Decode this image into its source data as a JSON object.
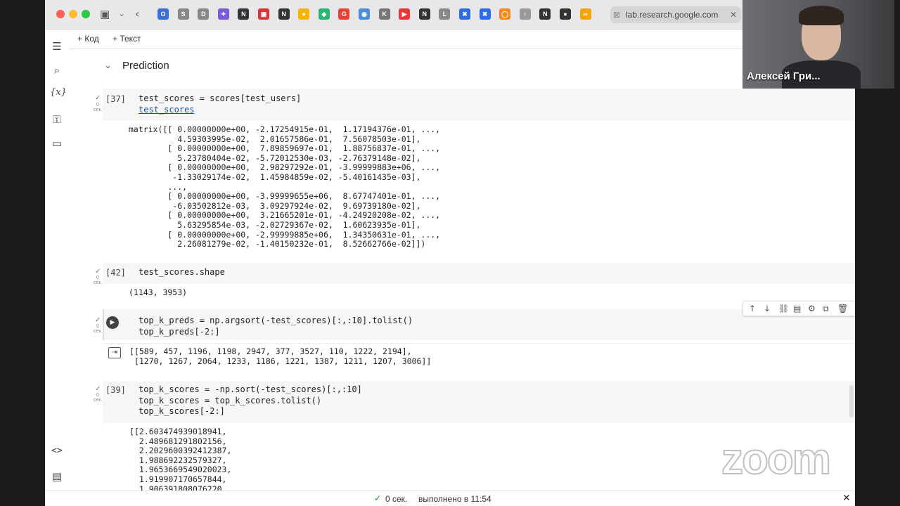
{
  "browser": {
    "url": "lab.research.google.com",
    "tab_icons": [
      "O",
      "S",
      "D",
      "✦",
      "N",
      "▣",
      "N",
      "●",
      "◆",
      "G",
      "◉",
      "K",
      "▶",
      "N",
      "L",
      "✖",
      "✖",
      "◯",
      "♀",
      "N",
      "●",
      "∞"
    ]
  },
  "toolbar": {
    "add_code": "+ Код",
    "add_text": "+ Текст"
  },
  "section": {
    "title": "Prediction"
  },
  "cells": [
    {
      "exec": "[37]",
      "time": "0\nсек.",
      "code": [
        "test_scores = scores[test_users]",
        "test_scores"
      ],
      "output": "matrix([[ 0.00000000e+00, -2.17254915e-01,  1.17194376e-01, ...,\n          4.59303995e-02,  2.01657586e-01,  7.56078503e-01],\n        [ 0.00000000e+00,  7.89859697e-01,  1.88756837e-01, ...,\n          5.23780404e-02, -5.72012530e-03, -2.76379148e-02],\n        [ 0.00000000e+00,  2.98297292e-01, -3.99999883e+06, ...,\n         -1.33029174e-02,  1.45984859e-02, -5.40161435e-03],\n        ...,\n        [ 0.00000000e+00, -3.99999655e+06,  8.67747401e-01, ...,\n         -6.03502812e-03,  3.09297924e-02,  9.69739180e-02],\n        [ 0.00000000e+00,  3.21665201e-01, -4.24920208e-02, ...,\n          5.63295854e-03, -2.02729367e-02,  1.60623935e-01],\n        [ 0.00000000e+00, -2.99999885e+06,  1.34350631e-01, ...,\n          2.26081279e-02, -1.40150232e-01,  8.52662766e-02]])"
    },
    {
      "exec": "[42]",
      "time": "0\nсек.",
      "code": [
        "test_scores.shape"
      ],
      "output": "(1143, 3953)"
    },
    {
      "exec": "",
      "time": "0\nсек.",
      "code": [
        "top_k_preds = np.argsort(-test_scores)[:,:10].tolist()",
        "top_k_preds[-2:]"
      ],
      "output": "[[589, 457, 1196, 1198, 2947, 377, 3527, 110, 1222, 2194],\n [1270, 1267, 2064, 1233, 1186, 1221, 1387, 1211, 1207, 3006]]"
    },
    {
      "exec": "[39]",
      "time": "0\nсек.",
      "code": [
        "top_k_scores = -np.sort(-test_scores)[:,:10]",
        "top_k_scores = top_k_scores.tolist()",
        "top_k_scores[-2:]"
      ],
      "output": "[[2.603474939018941,\n  2.489681291802156,\n  2.2029600392412387,\n  1.988692232579327,\n  1.9653669549020023,\n  1.919907170657844,\n  1.906391808076220"
    }
  ],
  "status": {
    "check": "✓",
    "time": "0 сек.",
    "done": "выполнено в 11:54"
  },
  "video": {
    "name": "Алексей Гри..."
  },
  "zoom_logo": "zoom"
}
